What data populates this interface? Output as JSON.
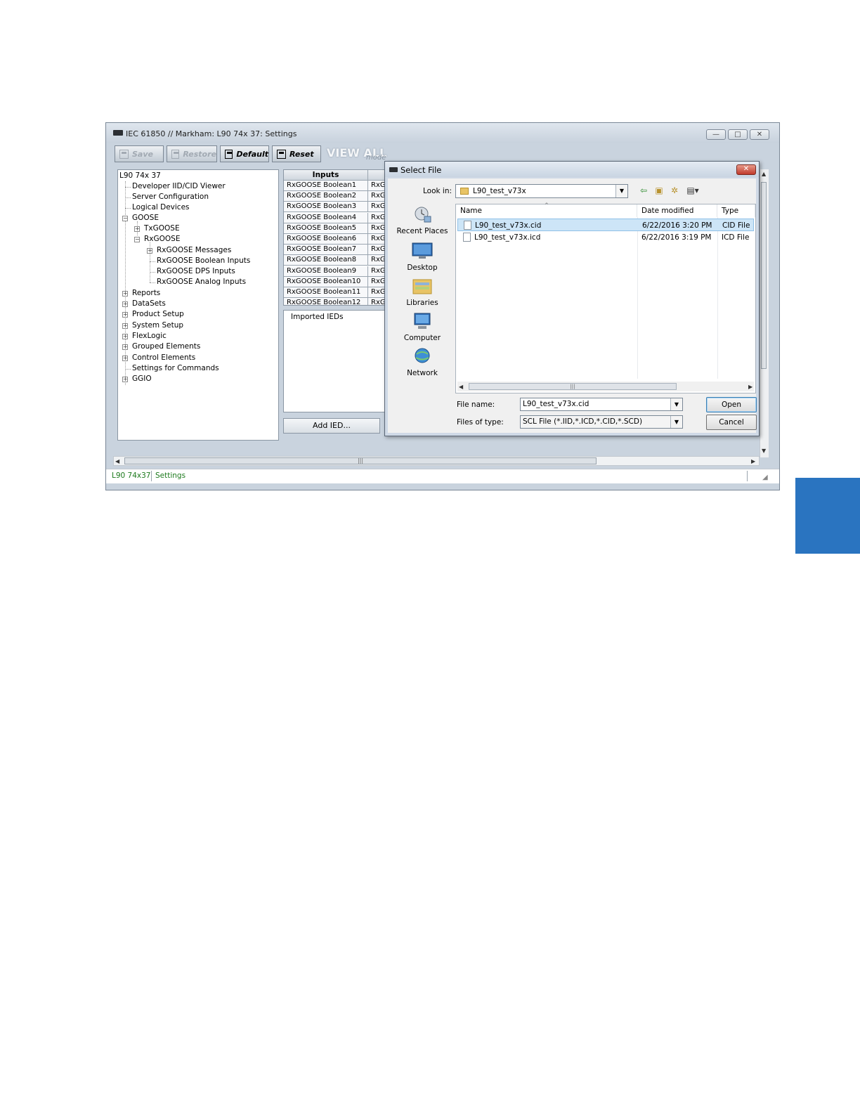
{
  "window": {
    "title": "IEC 61850 // Markham: L90 74x 37: Settings",
    "controls": {
      "minimize": "—",
      "maximize": "□",
      "close": "✕"
    }
  },
  "toolbar": {
    "save": "Save",
    "restore": "Restore",
    "default": "Default",
    "reset": "Reset",
    "view_all": "VIEW ALL",
    "mode": "mode"
  },
  "tree": {
    "root": "L90 74x 37",
    "items": [
      "Developer IID/CID Viewer",
      "Server Configuration",
      "Logical Devices",
      "GOOSE",
      "TxGOOSE",
      "RxGOOSE",
      "RxGOOSE Messages",
      "RxGOOSE Boolean Inputs",
      "RxGOOSE DPS Inputs",
      "RxGOOSE Analog Inputs",
      "Reports",
      "DataSets",
      "Product Setup",
      "System Setup",
      "FlexLogic",
      "Grouped Elements",
      "Control Elements",
      "Settings for Commands",
      "GGIO"
    ]
  },
  "inputs_table": {
    "header": "Inputs",
    "rows": [
      [
        "RxGOOSE Boolean1",
        "RxG"
      ],
      [
        "RxGOOSE Boolean2",
        "RxG"
      ],
      [
        "RxGOOSE Boolean3",
        "RxG"
      ],
      [
        "RxGOOSE Boolean4",
        "RxG"
      ],
      [
        "RxGOOSE Boolean5",
        "RxG"
      ],
      [
        "RxGOOSE Boolean6",
        "RxG"
      ],
      [
        "RxGOOSE Boolean7",
        "RxG"
      ],
      [
        "RxGOOSE Boolean8",
        "RxG"
      ],
      [
        "RxGOOSE Boolean9",
        "RxG"
      ],
      [
        "RxGOOSE Boolean10",
        "RxG"
      ],
      [
        "RxGOOSE Boolean11",
        "RxG"
      ],
      [
        "RxGOOSE Boolean12",
        "RxG"
      ]
    ]
  },
  "ied_panel": {
    "label": "Imported IEDs",
    "add_button": "Add IED..."
  },
  "statusbar": {
    "device": "L90 74x37",
    "section": "Settings"
  },
  "dialog": {
    "title": "Select File",
    "close": "✕",
    "look_in_label": "Look in:",
    "look_in_value": "L90_test_v73x",
    "places": [
      "Recent Places",
      "Desktop",
      "Libraries",
      "Computer",
      "Network"
    ],
    "columns": [
      "Name",
      "Date modified",
      "Type"
    ],
    "files": [
      {
        "name": "L90_test_v73x.cid",
        "date": "6/22/2016 3:20 PM",
        "type": "CID File",
        "selected": true
      },
      {
        "name": "L90_test_v73x.icd",
        "date": "6/22/2016 3:19 PM",
        "type": "ICD File",
        "selected": false
      }
    ],
    "file_name_label": "File name:",
    "file_name_value": "L90_test_v73x.cid",
    "file_type_label": "Files of type:",
    "file_type_value": "SCL File (*.IID,*.ICD,*.CID,*.SCD)",
    "open": "Open",
    "cancel": "Cancel"
  },
  "colors": {
    "side_tab": "#2a74c0",
    "status_text": "#1d7a1d",
    "selection": "#cde5f7"
  }
}
